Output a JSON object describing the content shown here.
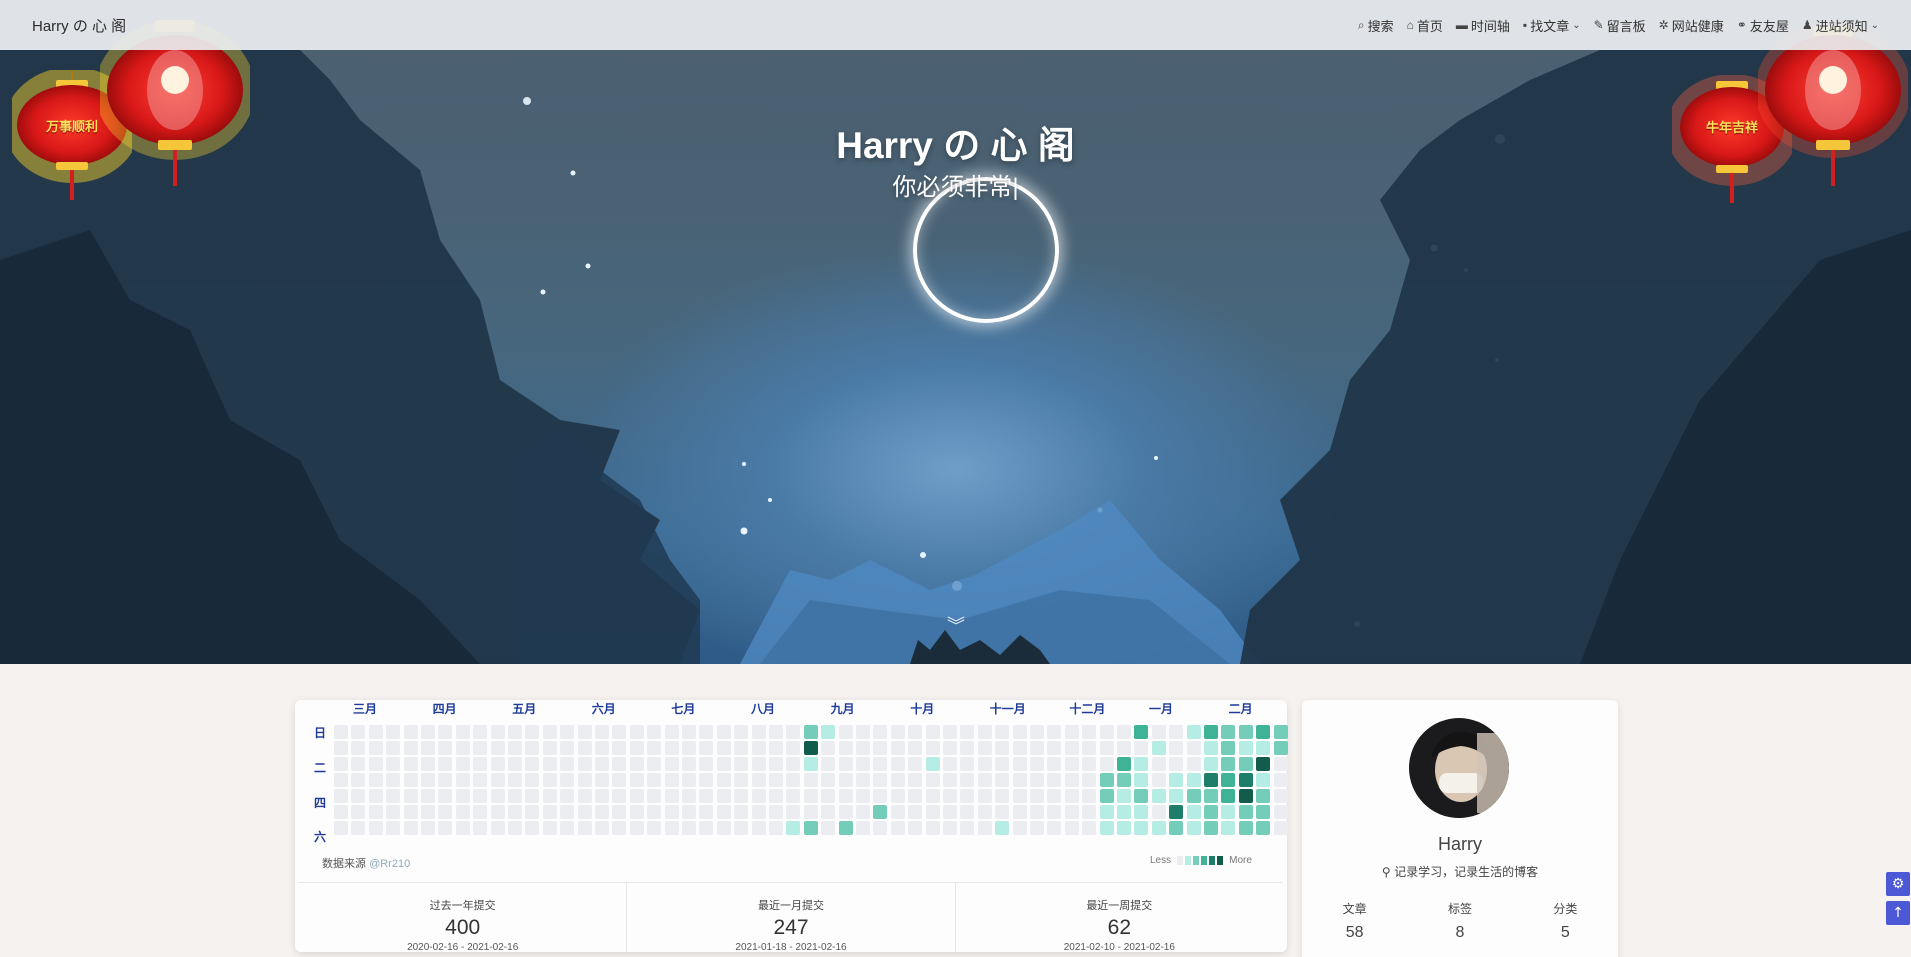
{
  "navbar": {
    "brand": "Harry の 心 阁",
    "items": [
      {
        "icon": "search-icon",
        "glyph": "⌕",
        "label": "搜索",
        "dropdown": false
      },
      {
        "icon": "home-icon",
        "glyph": "⌂",
        "label": "首页",
        "dropdown": false
      },
      {
        "icon": "archive-icon",
        "glyph": "▬",
        "label": "时间轴",
        "dropdown": false
      },
      {
        "icon": "cubes-icon",
        "glyph": "▪",
        "label": "找文章",
        "dropdown": true
      },
      {
        "icon": "feather-icon",
        "glyph": "✎",
        "label": "留言板",
        "dropdown": false
      },
      {
        "icon": "bug-icon",
        "glyph": "✲",
        "label": "网站健康",
        "dropdown": false
      },
      {
        "icon": "link-icon",
        "glyph": "⚭",
        "label": "友友屋",
        "dropdown": false
      },
      {
        "icon": "user-icon",
        "glyph": "♟",
        "label": "进站须知",
        "dropdown": true
      }
    ]
  },
  "hero": {
    "title": "Harry の 心 阁",
    "subtitle": "你必须非常|"
  },
  "lanterns": {
    "left_label": "万事顺利",
    "right_label": "牛年吉祥"
  },
  "heatmap": {
    "months": [
      "三月",
      "四月",
      "五月",
      "六月",
      "七月",
      "八月",
      "九月",
      "十月",
      "十一月",
      "十二月",
      "一月",
      "二月"
    ],
    "day_labels": [
      "日",
      "二",
      "四",
      "六"
    ],
    "source_label": "数据来源",
    "source_user": "@Rr210",
    "legend_less": "Less",
    "legend_more": "More",
    "colors": [
      "#ebedf0",
      "#b5ede4",
      "#74cdb8",
      "#3fb396",
      "#1f7e69",
      "#115c4b"
    ],
    "active_cells": [
      [
        26,
        6,
        1
      ],
      [
        27,
        0,
        2
      ],
      [
        27,
        1,
        5
      ],
      [
        27,
        2,
        1
      ],
      [
        27,
        6,
        2
      ],
      [
        28,
        0,
        1
      ],
      [
        29,
        6,
        2
      ],
      [
        31,
        5,
        2
      ],
      [
        34,
        2,
        1
      ],
      [
        38,
        6,
        1
      ],
      [
        44,
        3,
        2
      ],
      [
        44,
        4,
        2
      ],
      [
        44,
        5,
        1
      ],
      [
        44,
        6,
        1
      ],
      [
        45,
        2,
        3
      ],
      [
        45,
        3,
        2
      ],
      [
        45,
        4,
        1
      ],
      [
        45,
        5,
        1
      ],
      [
        45,
        6,
        1
      ],
      [
        46,
        0,
        3
      ],
      [
        46,
        2,
        1
      ],
      [
        46,
        3,
        1
      ],
      [
        46,
        4,
        2
      ],
      [
        46,
        5,
        1
      ],
      [
        46,
        6,
        1
      ],
      [
        47,
        1,
        1
      ],
      [
        47,
        4,
        1
      ],
      [
        47,
        6,
        1
      ],
      [
        48,
        3,
        1
      ],
      [
        48,
        4,
        1
      ],
      [
        48,
        5,
        4
      ],
      [
        48,
        6,
        2
      ],
      [
        49,
        0,
        1
      ],
      [
        49,
        3,
        1
      ],
      [
        49,
        4,
        2
      ],
      [
        49,
        5,
        1
      ],
      [
        49,
        6,
        1
      ],
      [
        50,
        0,
        3
      ],
      [
        50,
        1,
        1
      ],
      [
        50,
        2,
        1
      ],
      [
        50,
        3,
        4
      ],
      [
        50,
        4,
        2
      ],
      [
        50,
        5,
        2
      ],
      [
        50,
        6,
        2
      ],
      [
        51,
        0,
        2
      ],
      [
        51,
        1,
        2
      ],
      [
        51,
        2,
        2
      ],
      [
        51,
        3,
        3
      ],
      [
        51,
        4,
        3
      ],
      [
        51,
        5,
        1
      ],
      [
        51,
        6,
        1
      ],
      [
        52,
        0,
        2
      ],
      [
        52,
        1,
        1
      ],
      [
        52,
        2,
        2
      ],
      [
        52,
        3,
        4
      ],
      [
        52,
        4,
        5
      ],
      [
        52,
        5,
        2
      ],
      [
        52,
        6,
        2
      ],
      [
        53,
        0,
        3
      ],
      [
        53,
        1,
        1
      ],
      [
        53,
        2,
        5
      ],
      [
        53,
        3,
        1
      ],
      [
        53,
        4,
        2
      ],
      [
        53,
        5,
        2
      ],
      [
        53,
        6,
        2
      ],
      [
        54,
        0,
        2
      ],
      [
        54,
        1,
        2
      ]
    ],
    "stats": [
      {
        "label": "过去一年提交",
        "value": "400",
        "range": "2020-02-16 - 2021-02-16"
      },
      {
        "label": "最近一月提交",
        "value": "247",
        "range": "2021-01-18 - 2021-02-16"
      },
      {
        "label": "最近一周提交",
        "value": "62",
        "range": "2021-02-10 - 2021-02-16"
      }
    ]
  },
  "profile": {
    "name": "Harry",
    "location_icon": "map-marker-icon",
    "motto": "记录学习，记录生活的博客",
    "stats": [
      {
        "label": "文章",
        "value": "58"
      },
      {
        "label": "标签",
        "value": "8"
      },
      {
        "label": "分类",
        "value": "5"
      }
    ]
  },
  "floating_buttons": [
    {
      "icon": "gear-icon",
      "glyph": "⚙"
    },
    {
      "icon": "arrow-up-icon",
      "glyph": "↑"
    }
  ]
}
